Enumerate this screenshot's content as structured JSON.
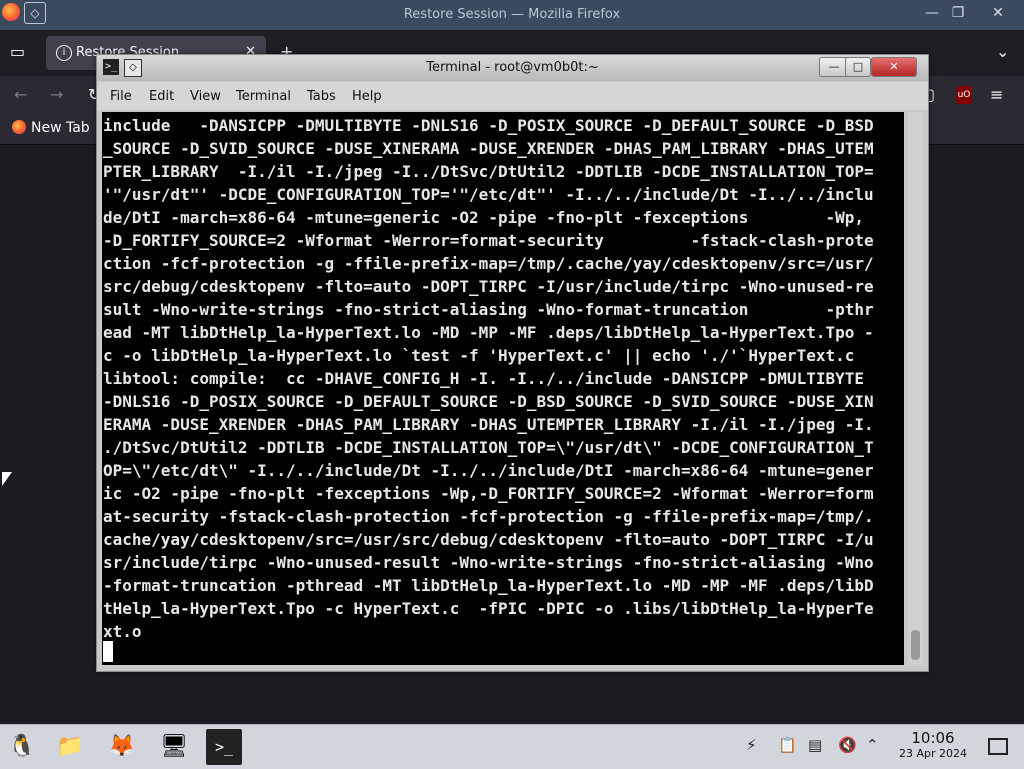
{
  "firefox": {
    "window_title": "Restore Session — Mozilla Firefox",
    "tab_label": "Restore Session",
    "bookmark_label": "New Tab",
    "ublock_badge": "uO",
    "pin_icon": "◇",
    "wctl_min": "—",
    "wctl_max": "❐",
    "wctl_close": "✕"
  },
  "terminal": {
    "window_title": "Terminal - root@vm0b0t:~",
    "icon_glyph": ">_",
    "pin_glyph": "◇",
    "btn_min": "—",
    "btn_max": "□",
    "btn_close": "✕",
    "menu": [
      "File",
      "Edit",
      "View",
      "Terminal",
      "Tabs",
      "Help"
    ],
    "output": "include   -DANSICPP -DMULTIBYTE -DNLS16 -D_POSIX_SOURCE -D_DEFAULT_SOURCE -D_BSD\n_SOURCE -D_SVID_SOURCE -DUSE_XINERAMA -DUSE_XRENDER -DHAS_PAM_LIBRARY -DHAS_UTEM\nPTER_LIBRARY  -I./il -I./jpeg -I../DtSvc/DtUtil2 -DDTLIB -DCDE_INSTALLATION_TOP=\n'\"/usr/dt\"' -DCDE_CONFIGURATION_TOP='\"/etc/dt\"' -I../../include/Dt -I../../inclu\nde/DtI -march=x86-64 -mtune=generic -O2 -pipe -fno-plt -fexceptions        -Wp,\n-D_FORTIFY_SOURCE=2 -Wformat -Werror=format-security         -fstack-clash-prote\nction -fcf-protection -g -ffile-prefix-map=/tmp/.cache/yay/cdesktopenv/src=/usr/\nsrc/debug/cdesktopenv -flto=auto -DOPT_TIRPC -I/usr/include/tirpc -Wno-unused-re\nsult -Wno-write-strings -fno-strict-aliasing -Wno-format-truncation        -pthr\nead -MT libDtHelp_la-HyperText.lo -MD -MP -MF .deps/libDtHelp_la-HyperText.Tpo -\nc -o libDtHelp_la-HyperText.lo `test -f 'HyperText.c' || echo './'`HyperText.c\nlibtool: compile:  cc -DHAVE_CONFIG_H -I. -I../../include -DANSICPP -DMULTIBYTE\n-DNLS16 -D_POSIX_SOURCE -D_DEFAULT_SOURCE -D_BSD_SOURCE -D_SVID_SOURCE -DUSE_XIN\nERAMA -DUSE_XRENDER -DHAS_PAM_LIBRARY -DHAS_UTEMPTER_LIBRARY -I./il -I./jpeg -I.\n./DtSvc/DtUtil2 -DDTLIB -DCDE_INSTALLATION_TOP=\\\"/usr/dt\\\" -DCDE_CONFIGURATION_T\nOP=\\\"/etc/dt\\\" -I../../include/Dt -I../../include/DtI -march=x86-64 -mtune=gener\nic -O2 -pipe -fno-plt -fexceptions -Wp,-D_FORTIFY_SOURCE=2 -Wformat -Werror=form\nat-security -fstack-clash-protection -fcf-protection -g -ffile-prefix-map=/tmp/.\ncache/yay/cdesktopenv/src=/usr/src/debug/cdesktopenv -flto=auto -DOPT_TIRPC -I/u\nsr/include/tirpc -Wno-unused-result -Wno-write-strings -fno-strict-aliasing -Wno\n-format-truncation -pthread -MT libDtHelp_la-HyperText.lo -MD -MP -MF .deps/libD\ntHelp_la-HyperText.Tpo -c HyperText.c  -fPIC -DPIC -o .libs/libDtHelp_la-HyperTe\nxt.o"
  },
  "taskbar": {
    "clock_time": "10:06",
    "clock_date": "23 Apr 2024"
  },
  "colors": {
    "terminal_bg": "#000000",
    "terminal_fg": "#e7e7e7",
    "firefox_chrome": "#2b2a33",
    "taskbar_bg": "#d2d6dc"
  }
}
